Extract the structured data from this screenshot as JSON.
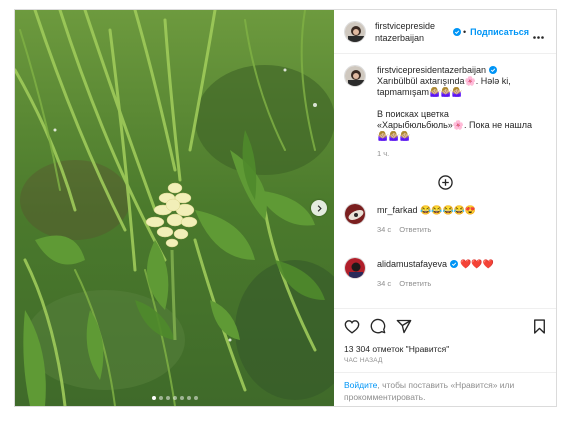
{
  "post": {
    "author": {
      "username": "firstvicepresidentazerbaijan",
      "username_head_line1": "firstvicepreside",
      "username_head_line2": "ntazerbaijan",
      "follow_label": "Подписаться",
      "separator": "•"
    },
    "caption": {
      "line1": "Xarıbülbül axtarışında🌸. Hələ ki,",
      "line2": "tapmamışam🤷🏼‍♀️🤷🏼‍♀️🤷🏼‍♀️",
      "line3": "В поисках цветка",
      "line4": "«Харыбюльбюль»🌸. Пока не нашла",
      "line5": "🤷🏼‍♀️🤷🏼‍♀️🤷🏼‍♀️",
      "time": "1 ч."
    },
    "comments": [
      {
        "username": "mr_farkad",
        "text": "😂😂😂😂😍",
        "time": "34 с",
        "reply_label": "Ответить"
      },
      {
        "username": "alidamustafayeva",
        "text": "❤️❤️❤️",
        "time": "34 с",
        "reply_label": "Ответить"
      }
    ],
    "likes": "13 304 отметок \"Нравится\"",
    "posted_ago": "ЧАС НАЗАД",
    "login_prompt": {
      "link": "Войдите",
      "rest_line1": ", чтобы поставить «Нравится» или",
      "rest_line2": "прокомментировать."
    },
    "carousel": {
      "count": 7,
      "active": 0
    },
    "colors": {
      "accent": "#0095f6",
      "verified": "#0095f6",
      "muted": "#8e8e8e",
      "heart": "#ed4956"
    },
    "icons": [
      "more-icon",
      "plus-circle-icon",
      "heart-icon",
      "comment-icon",
      "share-icon",
      "bookmark-icon",
      "chevron-right-icon",
      "verified-icon"
    ]
  }
}
